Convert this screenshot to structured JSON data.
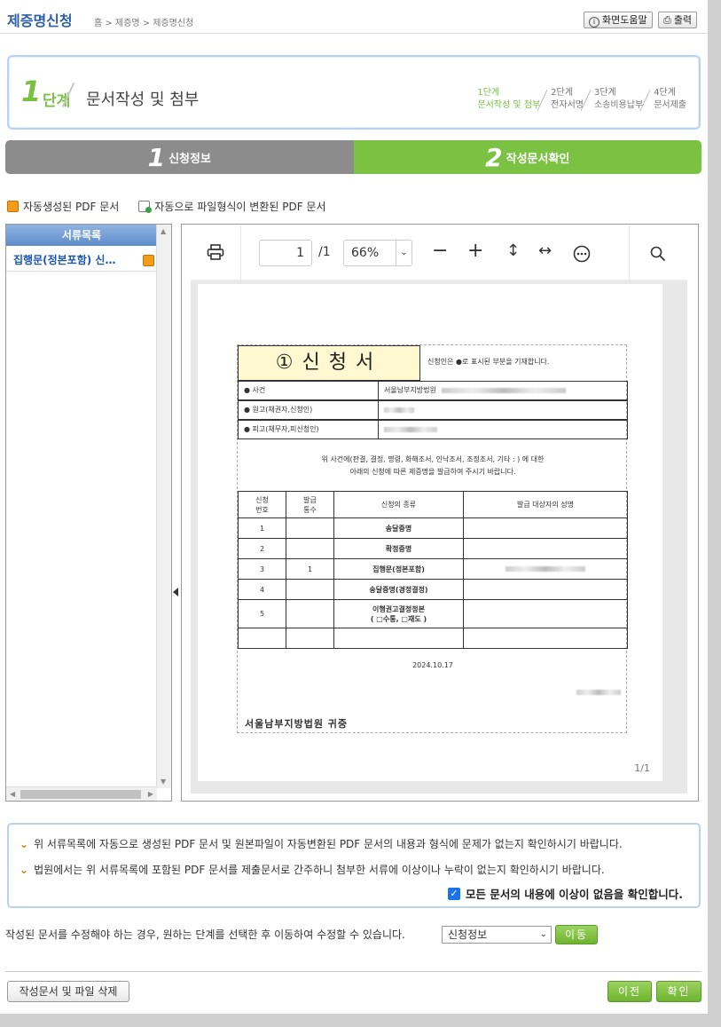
{
  "header": {
    "title": "제증명신청",
    "breadcrumb": "홈 > 제증명 > 제증명신청",
    "help_label": "화면도움말",
    "print_label": "출력"
  },
  "step_box": {
    "step_number": "1",
    "step_word": "단계",
    "step_title": "문서작성 및 첨부",
    "steps": [
      {
        "top": "1단계",
        "bottom": "문서작성 및 첨부",
        "active": true
      },
      {
        "top": "2단계",
        "bottom": "전자서명",
        "active": false
      },
      {
        "top": "3단계",
        "bottom": "소송비용납부",
        "active": false
      },
      {
        "top": "4단계",
        "bottom": "문서제출",
        "active": false
      }
    ]
  },
  "tabs": [
    {
      "num": "1",
      "label": "신청정보"
    },
    {
      "num": "2",
      "label": "작성문서확인"
    }
  ],
  "legend": {
    "pdf_label": "자동생성된 PDF 문서",
    "converted_label": "자동으로 파일형식이 변환된 PDF 문서"
  },
  "doc_list": {
    "header": "서류목록",
    "items": [
      "집행문(정본포함) 신…"
    ]
  },
  "viewer": {
    "page_current": "1",
    "page_total": "/1",
    "zoom": "66%",
    "page_indicator": "1/1",
    "icons": [
      "print-icon",
      "zoom-out-icon",
      "zoom-in-icon",
      "fit-height-icon",
      "fit-width-icon",
      "more-icon",
      "search-icon"
    ]
  },
  "form": {
    "title": "①신청서",
    "note": "신청인은 ●로 표시된 부분을 기재합니다.",
    "rows": [
      {
        "key": "● 사건",
        "value": "서울남부지방법원"
      },
      {
        "key": "● 원고(채권자,신청인)",
        "value": ""
      },
      {
        "key": "● 피고(채무자,피신청인)",
        "value": ""
      }
    ],
    "para_line1": "위 사건에(판결, 결정, 명령, 화해조서, 인낙조서, 조정조서, 기타 :                    ) 에 대한",
    "para_line2": "아래의 신청에 따른 제증명을 발급하여 주시기 바랍니다.",
    "table_headers": [
      "신청\n번호",
      "발급\n통수",
      "신청의 종류",
      "발급 대상자의 성명"
    ],
    "table_rows": [
      {
        "no": "1",
        "count": "",
        "kind": "송달증명"
      },
      {
        "no": "2",
        "count": "",
        "kind": "확정증명"
      },
      {
        "no": "3",
        "count": "1",
        "kind": "집행문(정본포함)"
      },
      {
        "no": "4",
        "count": "",
        "kind": "송달증명(경정결정)"
      },
      {
        "no": "5",
        "count": "",
        "kind": "이행권고결정정본\n( □수통, □재도 )"
      }
    ],
    "date": "2024.10.17",
    "court": "서울남부지방법원  귀중"
  },
  "confirm": {
    "line1": "위 서류목록에 자동으로 생성된 PDF 문서 및 원본파일이 자동변환된 PDF 문서의 내용과 형식에 문제가 없는지 확인하시기 바랍니다.",
    "line2": "법원에서는 위 서류목록에 포함된 PDF 문서를 제출문서로 간주하니 첨부한 서류에 이상이나 누락이 없는지 확인하시기 바랍니다.",
    "check_label": "모든 문서의 내용에 이상이 없음을 확인합니다.",
    "checked": true
  },
  "modify": {
    "text": "작성된 문서를 수정해야 하는 경우, 원하는 단계를 선택한 후 이동하여 수정할 수 있습니다.",
    "select_value": "신청정보",
    "move_label": "이동"
  },
  "footer": {
    "delete_label": "작성문서 및 파일 삭제",
    "prev_label": "이전",
    "confirm_label": "확인"
  },
  "colors": {
    "accent_green": "#7cc242",
    "header_blue": "#2c5fa8",
    "tab_gray": "#8c8c8c",
    "pdf_orange": "#f29d1a"
  }
}
